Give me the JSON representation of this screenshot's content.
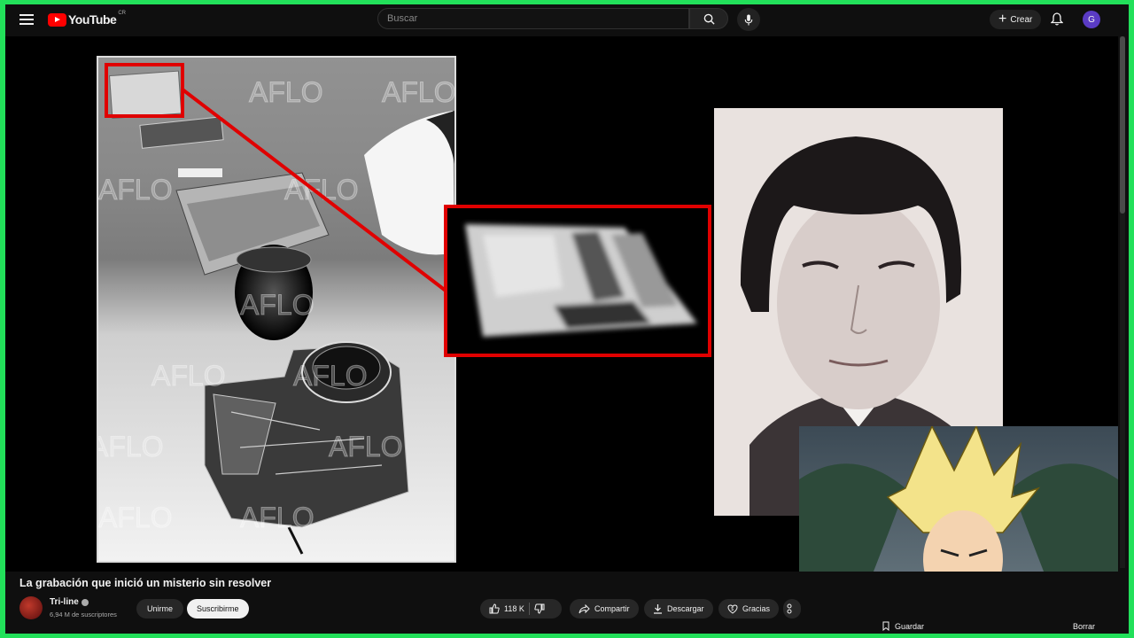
{
  "header": {
    "brand": "YouTube",
    "region": "CR",
    "search_placeholder": "Buscar",
    "create_label": "Crear",
    "avatar_letter": "G"
  },
  "video": {
    "watermark": "AFLO",
    "highlight_color": "#e00000"
  },
  "info": {
    "title": "La grabación que inició un misterio sin resolver",
    "channel_name": "Tri-line",
    "subscribers": "6,94 M de suscriptores",
    "join_label": "Unirme",
    "subscribe_label": "Suscribirme",
    "like_count": "118 K",
    "share_label": "Compartir",
    "download_label": "Descargar",
    "thanks_label": "Gracias",
    "save_label": "Guardar",
    "clear_label": "Borrar"
  },
  "colors": {
    "border": "#22e05a",
    "background": "#0f0f0f",
    "brand_red": "#ff0000"
  }
}
